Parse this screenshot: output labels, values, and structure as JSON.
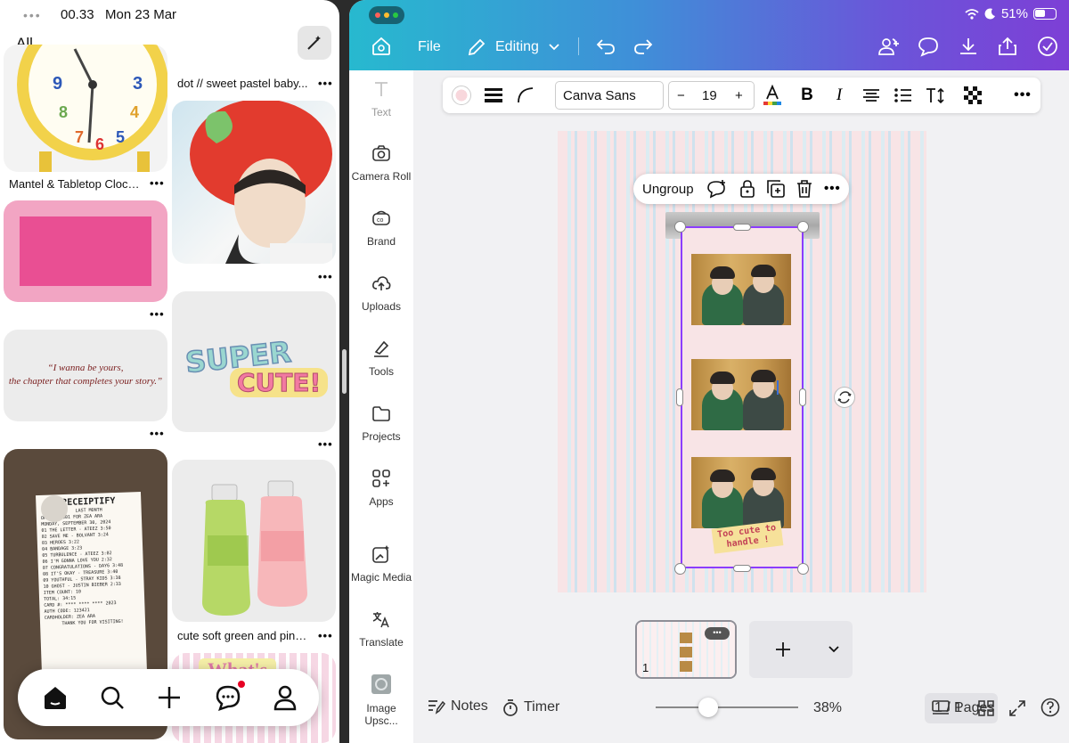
{
  "left_pane": {
    "status": {
      "dots": "•••",
      "time": "00.33",
      "date": "Mon 23 Mar"
    },
    "tabs": {
      "all": "All"
    },
    "pins": [
      {
        "caption": "Mantel & Tabletop Clocks..."
      },
      {
        "caption": "dot // sweet pastel baby..."
      },
      {
        "caption": "cute soft green and pink..."
      }
    ],
    "quote": {
      "line1": "“I wanna be yours,",
      "line2": "the chapter that completes your story.”"
    },
    "super_cute": {
      "line1": "SUPER",
      "line2": "CUTE!"
    },
    "receipt": {
      "title": "RECEIPTIFY",
      "subtitle": "LAST MONTH",
      "order": "ORDER #0001 FOR ZEA ARA",
      "date": "MONDAY, SEPTEMBER 30, 2024",
      "rows": [
        "01 THE LETTER - ATEEZ      3:50",
        "02 SAVE ME - BOLVANT       3:24",
        "03 HEROES                  3:22",
        "04 BANDAGE                 3:23",
        "05 TURBULENCE - ATEEZ      3:02",
        "06 I'M GONNA LOVE YOU      2:32",
        "07 CONGRATULATIONS - DAY6  3:48",
        "08 IT'S OKAY - TREASURE    3:40",
        "09 YOUTHFUL - STRAY KIDS   3:38",
        "10 GHOST - JUSTIN BIEBER   2:33"
      ],
      "item_count": "ITEM COUNT:  10",
      "total": "TOTAL:  34:15",
      "card": "CARD #: **** **** **** 2023",
      "auth": "AUTH CODE: 123421",
      "holder": "CARDHOLDER: ZEA ARA",
      "thanks": "THANK YOU FOR VISITING!"
    },
    "pastel_banner": "What's",
    "nav_icons": [
      "home-icon",
      "search-icon",
      "plus-icon",
      "messages-icon",
      "profile-icon"
    ]
  },
  "canva": {
    "status": {
      "battery": "51%"
    },
    "topbar": {
      "file": "File",
      "editing": "Editing"
    },
    "sidebar": [
      {
        "label": "Text",
        "icon": "text-icon"
      },
      {
        "label": "Camera Roll",
        "icon": "camera-icon"
      },
      {
        "label": "Brand",
        "icon": "brand-icon"
      },
      {
        "label": "Uploads",
        "icon": "uploads-icon"
      },
      {
        "label": "Tools",
        "icon": "tools-icon"
      },
      {
        "label": "Projects",
        "icon": "folder-icon"
      },
      {
        "label": "Apps",
        "icon": "apps-icon"
      },
      {
        "label": "Magic Media",
        "icon": "magic-media-icon"
      },
      {
        "label": "Translate",
        "icon": "translate-icon"
      },
      {
        "label": "Image Upsc...",
        "icon": "image-upscale-icon"
      }
    ],
    "format_bar": {
      "font": "Canva Sans",
      "size": "19",
      "minus": "−",
      "plus": "+"
    },
    "context_menu": {
      "ungroup": "Ungroup"
    },
    "sticker": {
      "line1": "Too cute to",
      "line2": "handle !"
    },
    "pages": {
      "thumb_number": "1",
      "current": "1 / 1"
    },
    "bottom": {
      "notes": "Notes",
      "timer": "Timer",
      "zoom": "38%",
      "pages": "Pages"
    },
    "accent_color": "#8b3dff"
  }
}
